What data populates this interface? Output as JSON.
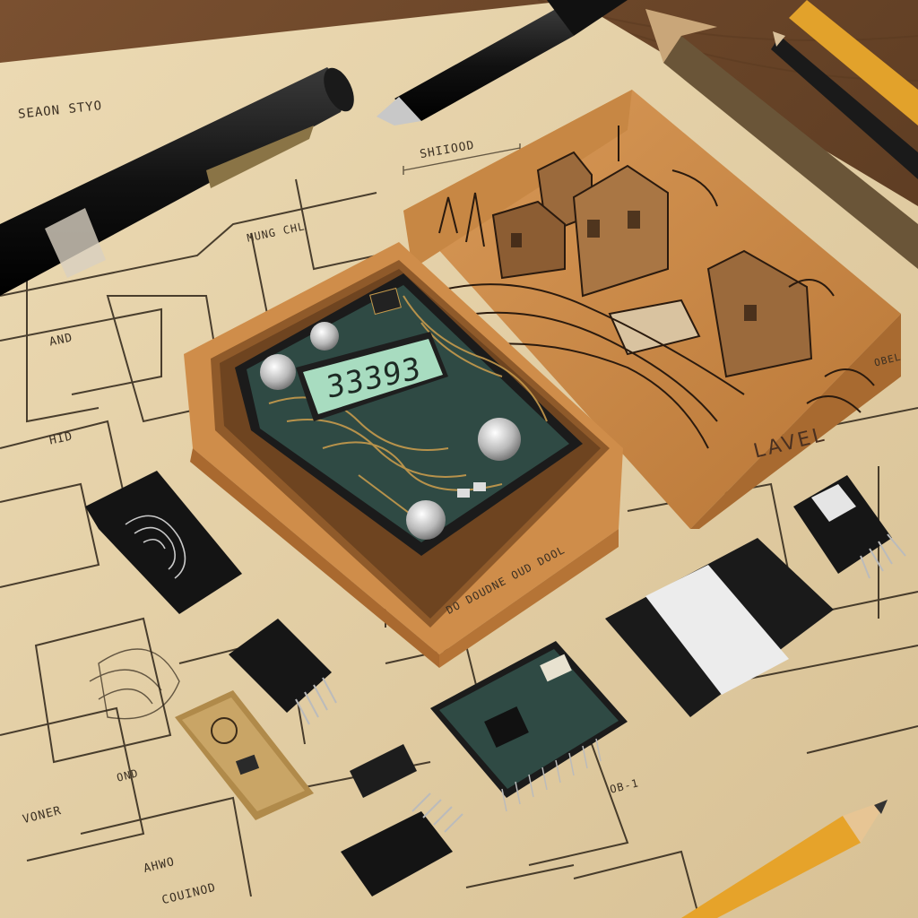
{
  "display_reading": "33393",
  "box_label": "LAVEL",
  "sheet_labels": {
    "top_left": "SEAON    STYO",
    "top_center": "SHIIOOD",
    "under_pen": "MUNG CHL",
    "left_mid": "AND",
    "left_lower": "HID",
    "bottom_left": "VONER",
    "bottom_left2": "AHWO",
    "bottom_left3": "COUINOD",
    "bottom_box_edge": "DO DOUDNE OUD DOOL",
    "right_small": "OBEL",
    "bottom_right": "OB-1",
    "mid_small": "OND"
  },
  "colors": {
    "wood": "#6b4526",
    "paper": "#e6d2a8",
    "cardboard": "#c98a49",
    "pcb": "#2f4a44",
    "lcd": "#a8dcc0"
  }
}
